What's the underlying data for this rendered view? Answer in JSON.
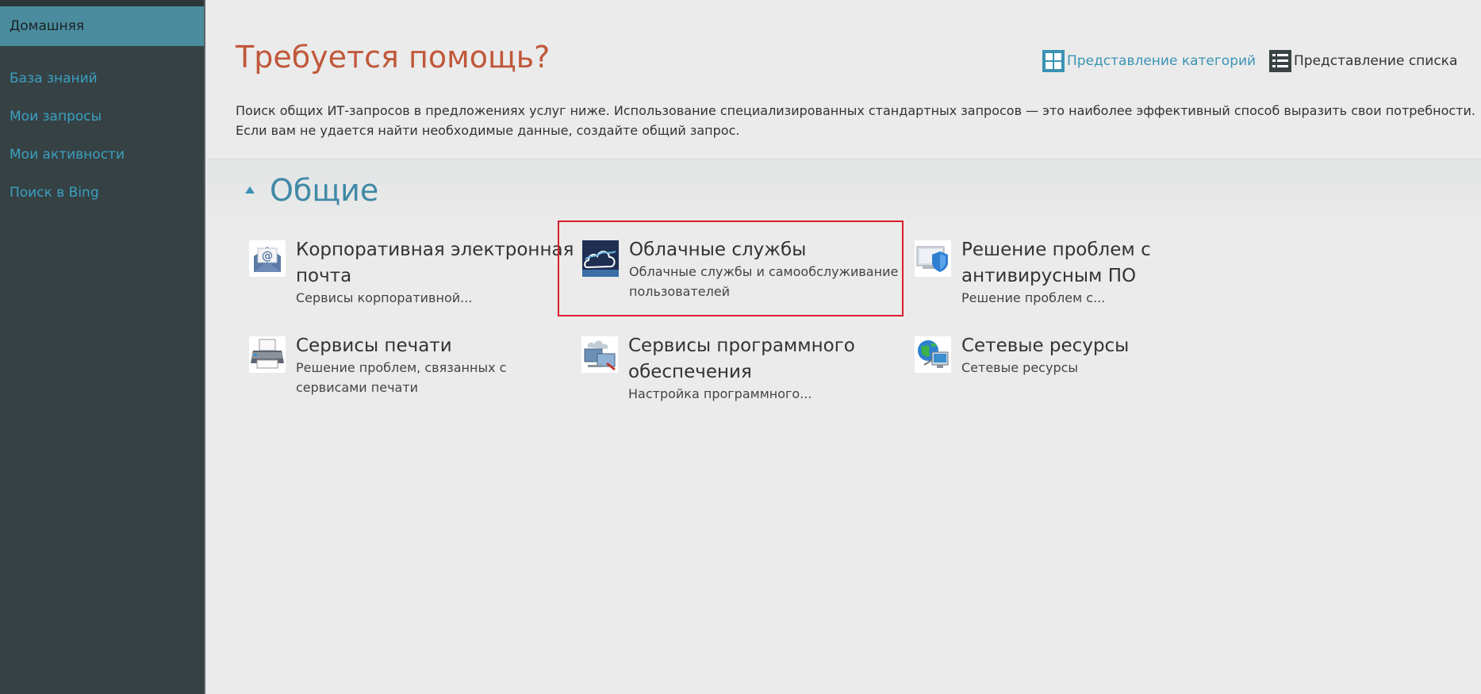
{
  "sidebar": {
    "items": [
      {
        "label": "Домашняя",
        "active": true
      },
      {
        "label": "База знаний"
      },
      {
        "label": "Мои запросы"
      },
      {
        "label": "Мои активности"
      },
      {
        "label": "Поиск в Bing"
      }
    ]
  },
  "header": {
    "title": "Требуется помощь?",
    "category_view_label": "Представление категорий",
    "list_view_label": "Представление списка",
    "description": "Поиск общих ИТ-запросов в предложениях услуг ниже. Использование специализированных стандартных запросов — это наиболее эффективный способ выразить свои потребности. Если вам не удается найти необходимые данные, создайте общий запрос."
  },
  "section": {
    "title": "Общие",
    "expanded": true
  },
  "tiles": [
    {
      "title": "Корпоративная электронная почта",
      "description": "Сервисы корпоративной...",
      "icon": "email-icon"
    },
    {
      "title": "Облачные службы",
      "description": "Облачные службы и самообслуживание пользователей",
      "icon": "cloud-icon",
      "selected": true
    },
    {
      "title": "Решение проблем с антивирусным ПО",
      "description": "Решение проблем с...",
      "icon": "antivirus-shield-icon"
    },
    {
      "title": "Сервисы печати",
      "description": "Решение проблем, связанных с сервисами печати",
      "icon": "printer-icon"
    },
    {
      "title": "Сервисы программного обеспечения",
      "description": "Настройка программного...",
      "icon": "software-icon"
    },
    {
      "title": "Сетевые ресурсы",
      "description": "Сетевые ресурсы",
      "icon": "network-globe-icon"
    }
  ],
  "colors": {
    "sidebar_bg": "#364144",
    "sidebar_active": "#4a8c9e",
    "link": "#3a93b4",
    "title": "#c0583a",
    "selection": "#d9202c"
  }
}
